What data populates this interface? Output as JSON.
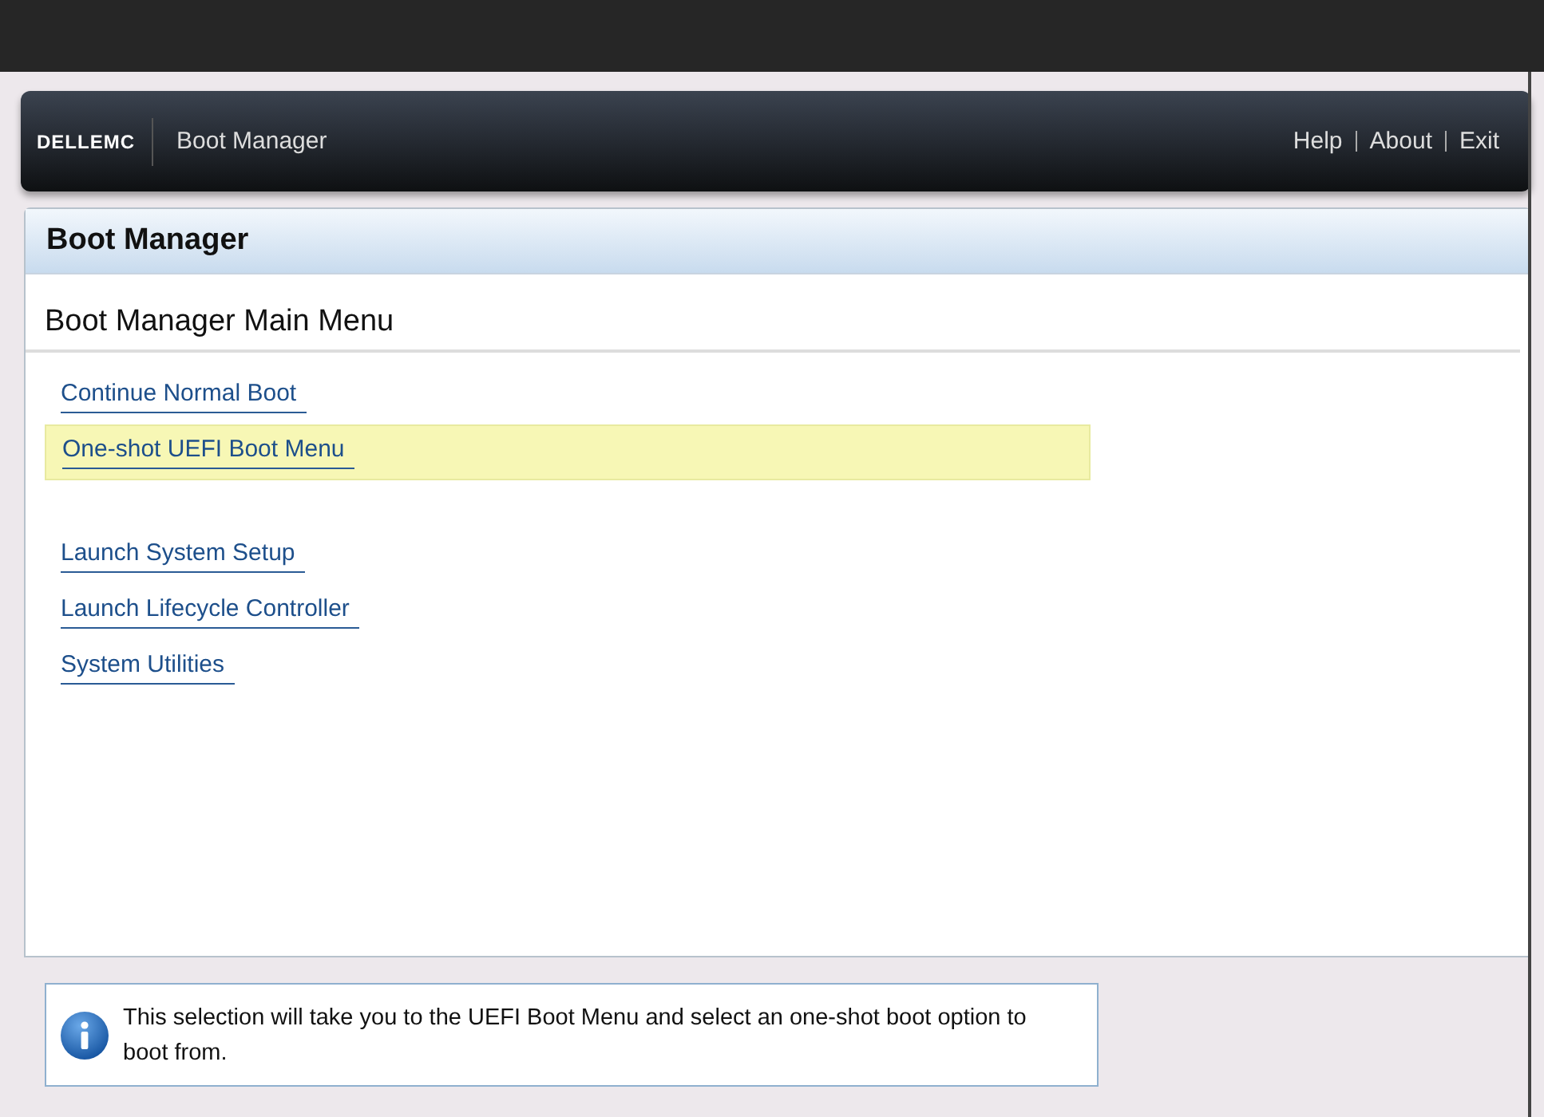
{
  "header": {
    "logo": "DELLEMC",
    "title": "Boot Manager",
    "links": [
      "Help",
      "About",
      "Exit"
    ]
  },
  "panel": {
    "title": "Boot Manager",
    "subtitle": "Boot Manager Main Menu",
    "groups": [
      [
        {
          "label": "Continue Normal Boot",
          "selected": false
        },
        {
          "label": "One-shot UEFI Boot Menu",
          "selected": true
        }
      ],
      [
        {
          "label": "Launch System Setup",
          "selected": false
        },
        {
          "label": "Launch Lifecycle Controller",
          "selected": false
        },
        {
          "label": "System Utilities",
          "selected": false
        }
      ]
    ]
  },
  "info": {
    "text": "This selection will take you to the UEFI Boot Menu and select an one-shot boot option to boot from."
  }
}
